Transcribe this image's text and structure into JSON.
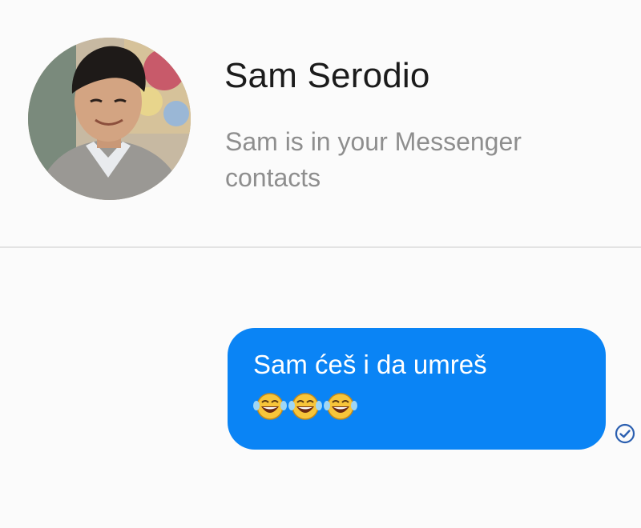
{
  "contact": {
    "name": "Sam Serodio",
    "subtitle": "Sam is in your Messenger contacts",
    "avatar_icon": "profile-photo-icon"
  },
  "conversation": {
    "messages": [
      {
        "direction": "outgoing",
        "text": "Sam ćeš i da umreš",
        "emojis": [
          "face-with-tears-of-joy-icon",
          "face-with-tears-of-joy-icon",
          "face-with-tears-of-joy-icon"
        ],
        "status_icon": "sent-check-icon"
      }
    ]
  },
  "colors": {
    "background": "#fbfbfb",
    "bubble_outgoing": "#0a84f5",
    "name_text": "#1b1b1b",
    "subtitle_text": "#8e8e8e",
    "receipt": "#2b5fb0"
  }
}
